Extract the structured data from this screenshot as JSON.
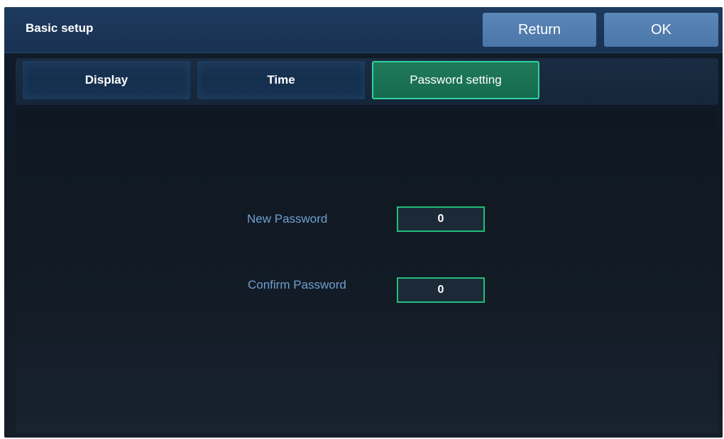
{
  "header": {
    "title": "Basic setup",
    "return_label": "Return",
    "ok_label": "OK"
  },
  "tabs": [
    {
      "label": "Display",
      "active": false
    },
    {
      "label": "Time",
      "active": false
    },
    {
      "label": "Password setting",
      "active": true
    }
  ],
  "form": {
    "new_password": {
      "label": "New Password",
      "value": "0"
    },
    "confirm_password": {
      "label": "Confirm Password",
      "value": "0"
    }
  },
  "colors": {
    "accent_active_tab": "#1f7a5a",
    "input_border": "#1fbf78",
    "button": "#5280b2",
    "label_text": "#6f9fd0"
  }
}
